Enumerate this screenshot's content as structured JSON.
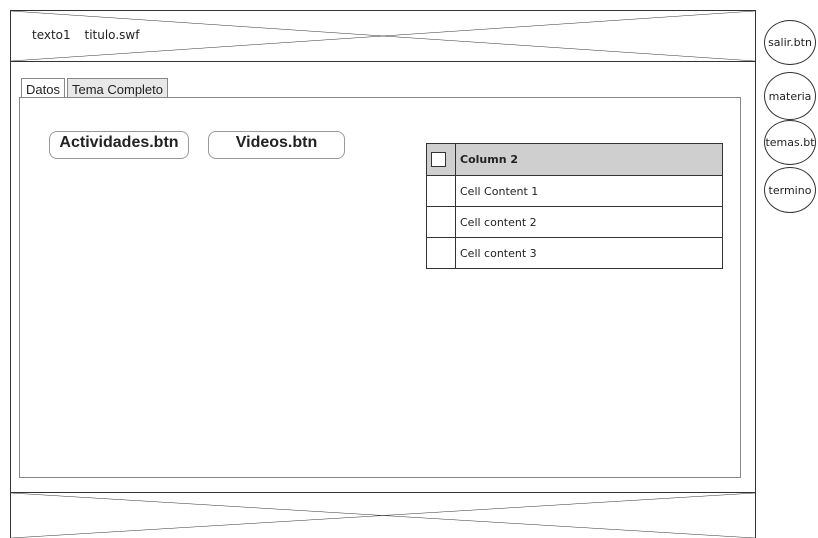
{
  "header": {
    "text1": "texto1",
    "text2": "titulo.swf"
  },
  "side_buttons": [
    {
      "label": "salir.btn"
    },
    {
      "label": "materia"
    },
    {
      "label": "temas.bt"
    },
    {
      "label": "termino"
    }
  ],
  "tabs": [
    {
      "label": "Datos"
    },
    {
      "label": "Tema Completo"
    }
  ],
  "buttons": {
    "actividades": "Actividades.btn",
    "videos": "Videos.btn"
  },
  "table": {
    "header": "Column 2",
    "rows": [
      "Cell Content 1",
      "Cell content 2",
      "Cell content 3"
    ]
  }
}
